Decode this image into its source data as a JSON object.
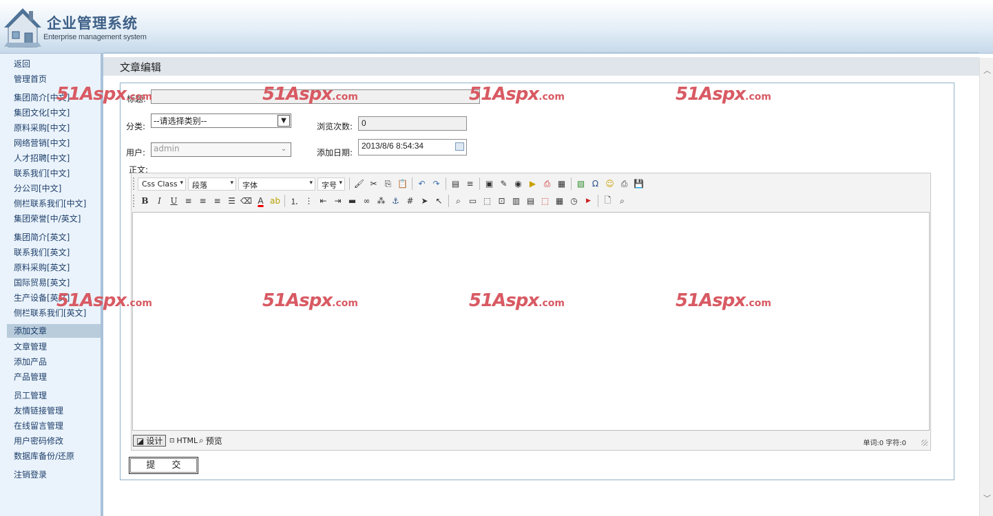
{
  "header": {
    "title": "企业管理系统",
    "subtitle": "Enterprise management system"
  },
  "sidebar": {
    "items": [
      {
        "label": "返回"
      },
      {
        "label": "管理首页"
      },
      {
        "label": "集团简介[中文]"
      },
      {
        "label": "集团文化[中文]"
      },
      {
        "label": "原料采购[中文]"
      },
      {
        "label": "网络营销[中文]"
      },
      {
        "label": "人才招聘[中文]"
      },
      {
        "label": "联系我们[中文]"
      },
      {
        "label": "分公司[中文]"
      },
      {
        "label": "侧栏联系我们[中文]"
      },
      {
        "label": "集团荣誉[中/英文]"
      },
      {
        "label": "集团简介[英文]"
      },
      {
        "label": "联系我们[英文]"
      },
      {
        "label": "原料采购[英文]"
      },
      {
        "label": "国际贸易[英文]"
      },
      {
        "label": "生产设备[英文]"
      },
      {
        "label": "侧栏联系我们[英文]"
      },
      {
        "label": "添加文章",
        "active": true
      },
      {
        "label": "文章管理"
      },
      {
        "label": "添加产品"
      },
      {
        "label": "产品管理"
      },
      {
        "label": "员工管理"
      },
      {
        "label": "友情链接管理"
      },
      {
        "label": "在线留言管理"
      },
      {
        "label": "用户密码修改"
      },
      {
        "label": "数据库备份/还原"
      },
      {
        "label": "注销登录"
      }
    ]
  },
  "page": {
    "title": "文章编辑"
  },
  "form": {
    "title_label": "标题:",
    "title_value": "",
    "category_label": "分类:",
    "category_selected": "--请选择类别--",
    "views_label": "浏览次数:",
    "views_value": "0",
    "user_label": "用户:",
    "user_selected": "admin",
    "date_label": "添加日期:",
    "date_value": "2013/8/6 8:54:34",
    "body_label": "正文:",
    "submit_label": "提 交"
  },
  "editor": {
    "dropdowns": {
      "css_class": "Css Class",
      "paragraph": "段落",
      "font": "字体",
      "font_size": "字号"
    },
    "mode_design": "设计",
    "mode_html": "HTML",
    "mode_preview": "预览",
    "counts": "单词:0 字符:0"
  },
  "watermark": {
    "brand": "51Aspx",
    "domain": ".com"
  },
  "colors": {
    "accent": "#3d5f86",
    "sidebar_bg": "#eaf3fb",
    "active_item_bg": "#b8ccdc",
    "watermark": "#d85a63"
  }
}
